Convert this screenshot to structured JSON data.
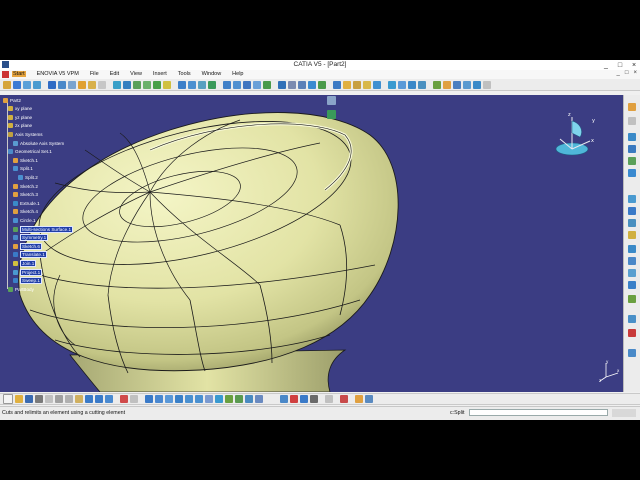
{
  "window": {
    "title": "CATIA V5 - [Part2]",
    "controls": [
      "_",
      "□",
      "×"
    ]
  },
  "menu": {
    "items": [
      "Start",
      "ENOVIA V5 VPM",
      "File",
      "Edit",
      "View",
      "Insert",
      "Tools",
      "Window",
      "Help"
    ],
    "active": "Start",
    "mdi_controls": [
      "_",
      "□",
      "×"
    ]
  },
  "tree": {
    "nodes": [
      {
        "label": "Part2",
        "depth": 0,
        "icon": "part-icon",
        "highlight": false
      },
      {
        "label": "xy plane",
        "depth": 1,
        "icon": "plane-icon",
        "highlight": false
      },
      {
        "label": "yz plane",
        "depth": 1,
        "icon": "plane-icon",
        "highlight": false
      },
      {
        "label": "zx plane",
        "depth": 1,
        "icon": "plane-icon",
        "highlight": false
      },
      {
        "label": "Axis Systems",
        "depth": 1,
        "icon": "folder-icon",
        "highlight": false
      },
      {
        "label": "Absolute Axis System",
        "depth": 2,
        "icon": "axis-system-icon",
        "highlight": false
      },
      {
        "label": "Geometrical Set.1",
        "depth": 1,
        "icon": "geometrical-set-icon",
        "highlight": false
      },
      {
        "label": "Sketch.1",
        "depth": 2,
        "icon": "sketch-icon",
        "highlight": false
      },
      {
        "label": "Split.1",
        "depth": 2,
        "icon": "split-icon",
        "highlight": false
      },
      {
        "label": "Split.2",
        "depth": 3,
        "icon": "split-icon",
        "highlight": false
      },
      {
        "label": "Sketch.2",
        "depth": 2,
        "icon": "sketch-icon",
        "highlight": false
      },
      {
        "label": "Sketch.3",
        "depth": 2,
        "icon": "sketch-icon",
        "highlight": false
      },
      {
        "label": "Extrude.1",
        "depth": 2,
        "icon": "extrude-icon",
        "highlight": false
      },
      {
        "label": "Sketch.4",
        "depth": 2,
        "icon": "sketch-icon",
        "highlight": false
      },
      {
        "label": "Circle.1",
        "depth": 2,
        "icon": "circle-icon",
        "highlight": false
      },
      {
        "label": "Multi-sections Surface.1",
        "depth": 2,
        "icon": "multi-section-surface-icon",
        "highlight": true
      },
      {
        "label": "Symmetry.1",
        "depth": 2,
        "icon": "symmetry-icon",
        "highlight": true
      },
      {
        "label": "Sketch.6",
        "depth": 2,
        "icon": "sketch-icon",
        "highlight": true
      },
      {
        "label": "Translate.1",
        "depth": 2,
        "icon": "translate-icon",
        "highlight": true
      },
      {
        "label": "Join.1",
        "depth": 2,
        "icon": "join-icon",
        "highlight": true
      },
      {
        "label": "Project.1",
        "depth": 2,
        "icon": "project-icon",
        "highlight": true
      },
      {
        "label": "Sweep.1",
        "depth": 2,
        "icon": "sweep-icon",
        "highlight": true
      },
      {
        "label": "PartBody",
        "depth": 1,
        "icon": "part-body-icon",
        "highlight": false
      }
    ]
  },
  "compass": {
    "x": "x",
    "y": "y",
    "z": "z"
  },
  "small_axes": {
    "x": "x",
    "y": "y",
    "z": "z"
  },
  "status": {
    "message": "Cuts and relimits an element using a cutting element",
    "command_label": "c:Split",
    "command_value": ""
  },
  "colors": {
    "viewport_bg": "#3b3d83",
    "surface": "#e2e3a5",
    "selection": "#1f3ea8",
    "menu_active": "#e7a53e"
  }
}
